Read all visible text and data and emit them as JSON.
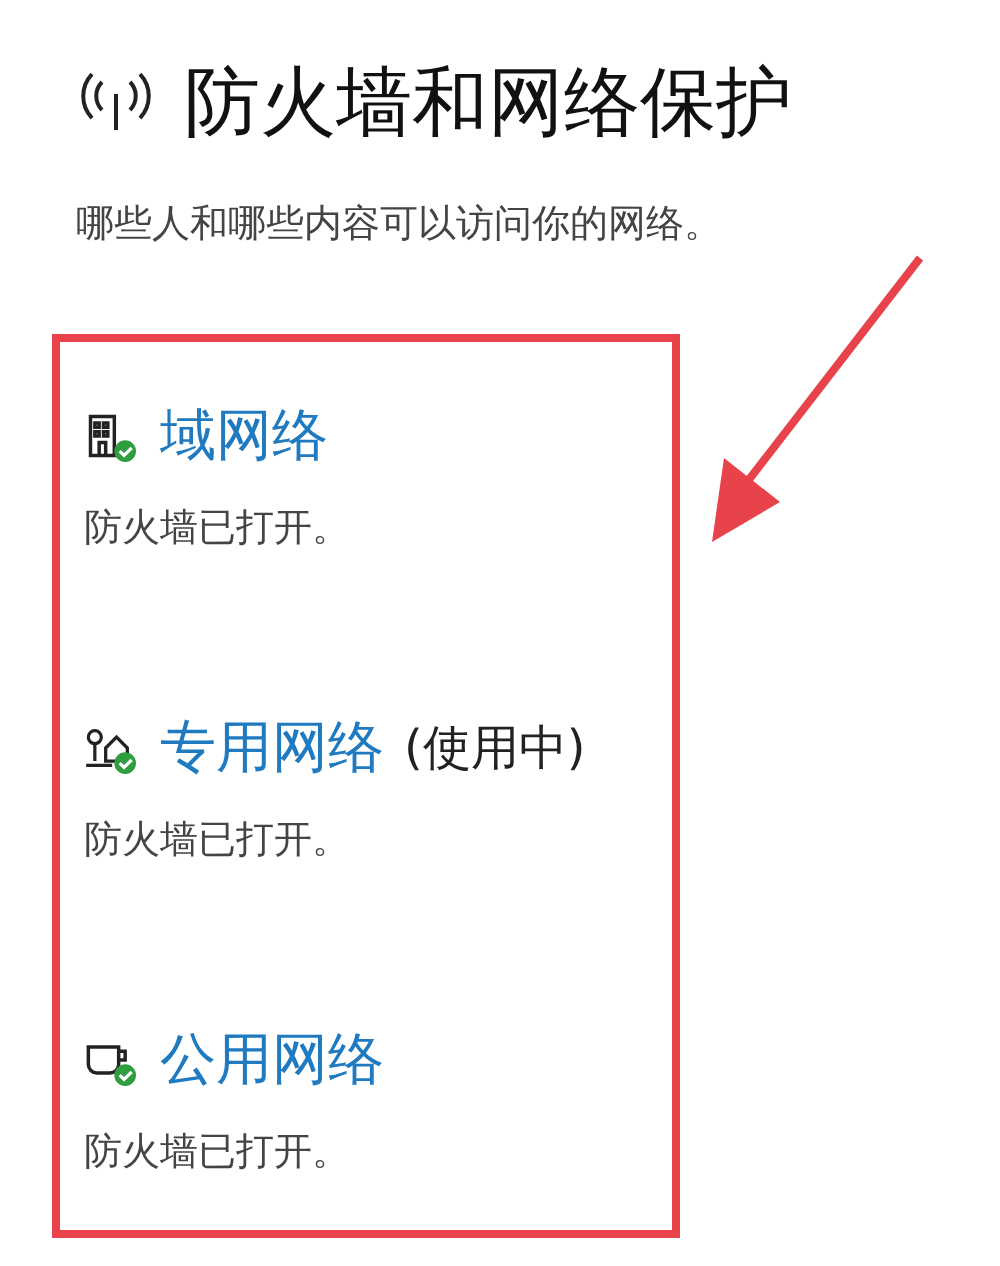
{
  "header": {
    "title": "防火墙和网络保护",
    "subtitle": "哪些人和哪些内容可以访问你的网络。"
  },
  "networks": [
    {
      "kind": "domain",
      "name": "域网络",
      "status": "防火墙已打开。"
    },
    {
      "kind": "private",
      "name": "专用网络",
      "in_use": "(使用中)",
      "status": "防火墙已打开。"
    },
    {
      "kind": "public",
      "name": "公用网络",
      "status": "防火墙已打开。"
    }
  ]
}
